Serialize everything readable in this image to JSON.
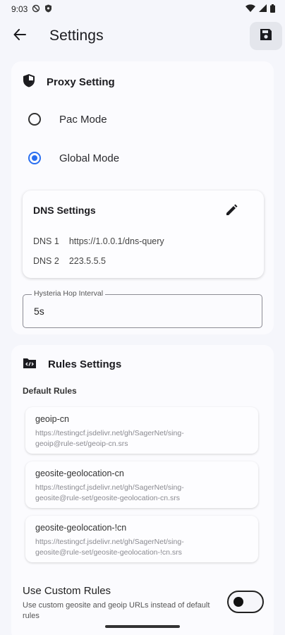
{
  "status_bar": {
    "time": "9:03",
    "left_icons": [
      "vpn-key-icon",
      "shield-status-icon"
    ],
    "right_icons": [
      "wifi-icon",
      "signal-icon",
      "battery-icon"
    ]
  },
  "app_bar": {
    "title": "Settings",
    "back_icon": "arrow-back-icon",
    "save_icon": "save-icon"
  },
  "proxy": {
    "title": "Proxy Setting",
    "modes": [
      {
        "label": "Pac Mode",
        "selected": false
      },
      {
        "label": "Global Mode",
        "selected": true
      }
    ],
    "dns": {
      "title": "DNS Settings",
      "rows": [
        {
          "key": "DNS 1",
          "value": "https://1.0.0.1/dns-query"
        },
        {
          "key": "DNS 2",
          "value": "223.5.5.5"
        }
      ]
    },
    "hop_interval": {
      "label": "Hysteria Hop Interval",
      "value": "5s"
    }
  },
  "rules": {
    "title": "Rules Settings",
    "default_label": "Default Rules",
    "items": [
      {
        "name": "geoip-cn",
        "url_line1": "https://testingcf.jsdelivr.net/gh/SagerNet/sing-",
        "url_line2": "geoip@rule-set/geoip-cn.srs"
      },
      {
        "name": "geosite-geolocation-cn",
        "url_line1": "https://testingcf.jsdelivr.net/gh/SagerNet/sing-",
        "url_line2": "geosite@rule-set/geosite-geolocation-cn.srs"
      },
      {
        "name": "geosite-geolocation-!cn",
        "url_line1": "https://testingcf.jsdelivr.net/gh/SagerNet/sing-",
        "url_line2": "geosite@rule-set/geosite-geolocation-!cn.srs"
      }
    ],
    "custom": {
      "title": "Use Custom Rules",
      "description": "Use custom geosite and geoip URLs instead of default rules",
      "enabled": false
    }
  },
  "colors": {
    "accent": "#2a6ff0",
    "background": "#f5f6fb",
    "card": "#fbfbfe"
  }
}
